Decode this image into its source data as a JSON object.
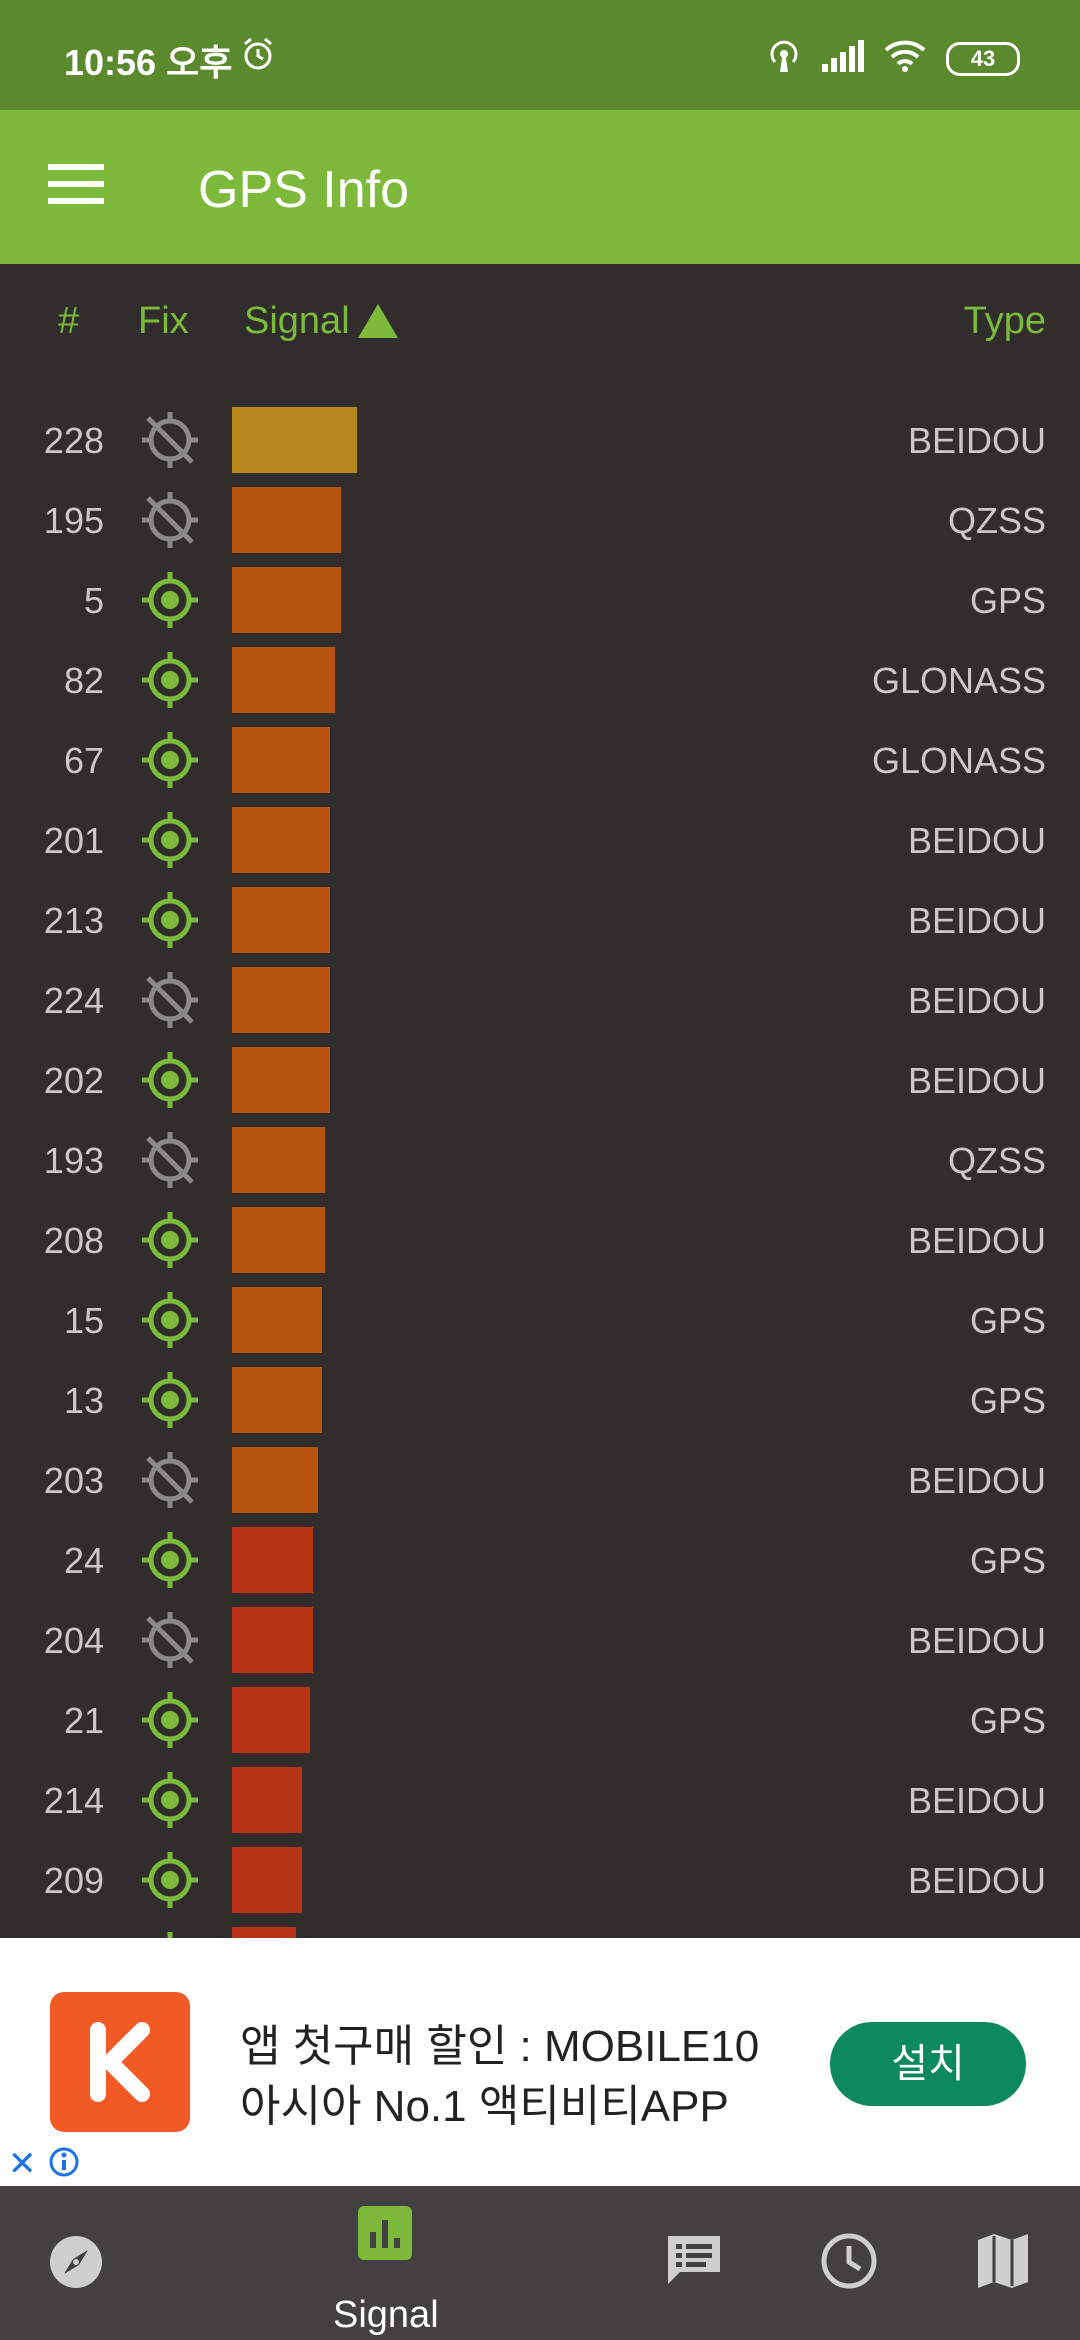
{
  "status_bar": {
    "time": "10:56 오후",
    "battery": "43",
    "icons": [
      "alarm-icon",
      "hotspot-icon",
      "cell-signal-icon",
      "wifi-icon",
      "battery-icon"
    ]
  },
  "app_bar": {
    "title": "GPS Info",
    "menu_icon": "menu-icon"
  },
  "columns": {
    "num": "#",
    "fix": "Fix",
    "signal": "Signal",
    "type": "Type",
    "sort_icon": "sort-ascending-triangle-icon"
  },
  "colors": {
    "status_bar": "#5b8a2e",
    "app_bar": "#7dba3c",
    "background": "#302d2c",
    "fix_used": "#7dba3c",
    "fix_unused": "#8a8a8a",
    "ad_button": "#0c8a5e"
  },
  "satellites": [
    {
      "num": "228",
      "fix": false,
      "signal": 0.147,
      "color": "#b8861a",
      "type": "BEIDOU"
    },
    {
      "num": "195",
      "fix": false,
      "signal": 0.129,
      "color": "#b8530f",
      "type": "QZSS"
    },
    {
      "num": "5",
      "fix": true,
      "signal": 0.129,
      "color": "#b8530f",
      "type": "GPS"
    },
    {
      "num": "82",
      "fix": true,
      "signal": 0.121,
      "color": "#b8530f",
      "type": "GLONASS"
    },
    {
      "num": "67",
      "fix": true,
      "signal": 0.115,
      "color": "#b8530f",
      "type": "GLONASS"
    },
    {
      "num": "201",
      "fix": true,
      "signal": 0.115,
      "color": "#b8530f",
      "type": "BEIDOU"
    },
    {
      "num": "213",
      "fix": true,
      "signal": 0.115,
      "color": "#b8530f",
      "type": "BEIDOU"
    },
    {
      "num": "224",
      "fix": false,
      "signal": 0.115,
      "color": "#b8530f",
      "type": "BEIDOU"
    },
    {
      "num": "202",
      "fix": true,
      "signal": 0.115,
      "color": "#b8530f",
      "type": "BEIDOU"
    },
    {
      "num": "193",
      "fix": false,
      "signal": 0.11,
      "color": "#b8530f",
      "type": "QZSS"
    },
    {
      "num": "208",
      "fix": true,
      "signal": 0.11,
      "color": "#b8530f",
      "type": "BEIDOU"
    },
    {
      "num": "15",
      "fix": true,
      "signal": 0.106,
      "color": "#b8530f",
      "type": "GPS"
    },
    {
      "num": "13",
      "fix": true,
      "signal": 0.106,
      "color": "#b8530f",
      "type": "GPS"
    },
    {
      "num": "203",
      "fix": false,
      "signal": 0.101,
      "color": "#b8530f",
      "type": "BEIDOU"
    },
    {
      "num": "24",
      "fix": true,
      "signal": 0.096,
      "color": "#b83214",
      "type": "GPS"
    },
    {
      "num": "204",
      "fix": false,
      "signal": 0.096,
      "color": "#b83214",
      "type": "BEIDOU"
    },
    {
      "num": "21",
      "fix": true,
      "signal": 0.092,
      "color": "#b83214",
      "type": "GPS"
    },
    {
      "num": "214",
      "fix": true,
      "signal": 0.082,
      "color": "#b83214",
      "type": "BEIDOU"
    },
    {
      "num": "209",
      "fix": true,
      "signal": 0.082,
      "color": "#b83214",
      "type": "BEIDOU"
    },
    {
      "num": "",
      "fix": true,
      "signal": 0.076,
      "color": "#b83214",
      "type": ""
    }
  ],
  "ad": {
    "line1": "앱 첫구매 할인 : MOBILE10",
    "line2": "아시아 No.1 액티비티APP",
    "button": "설치",
    "close": "✕",
    "logo_icon": "klook-k-logo",
    "info_icon": "ad-info-icon"
  },
  "bottom_nav": {
    "items": [
      "compass-icon",
      "signal-bars-icon",
      "messages-icon",
      "clock-icon",
      "map-icon"
    ],
    "active_label": "Signal"
  }
}
